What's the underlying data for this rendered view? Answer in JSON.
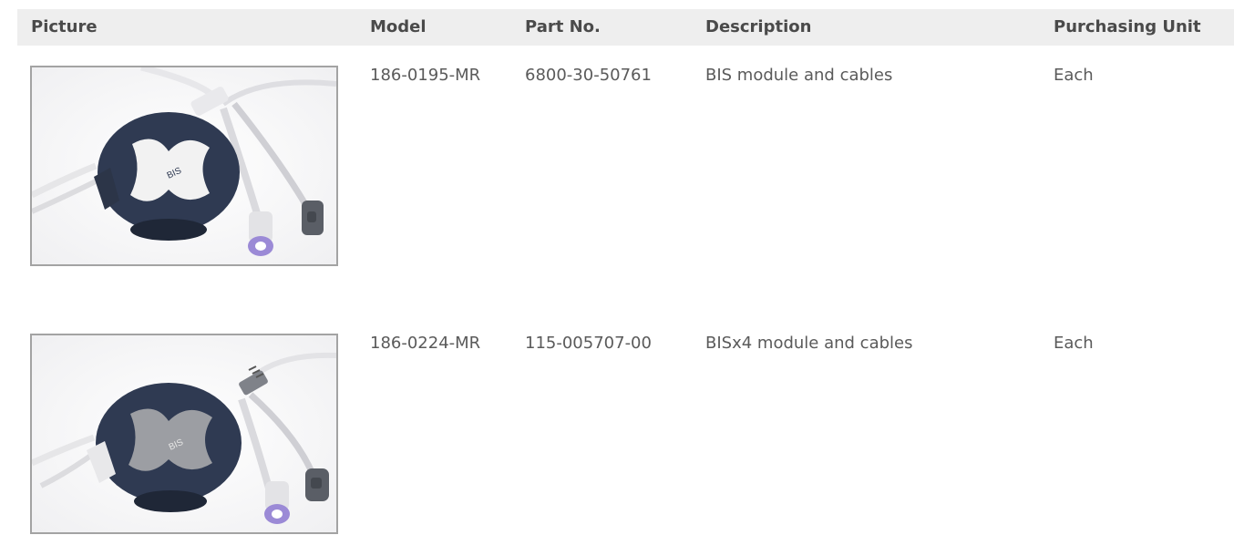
{
  "table": {
    "headers": {
      "picture": "Picture",
      "model": "Model",
      "part_no": "Part No.",
      "description": "Description",
      "purchasing_unit": "Purchasing Unit"
    },
    "rows": [
      {
        "picture": "bis-module-photo",
        "model": "186-0195-MR",
        "part_no": "6800-30-50761",
        "description": "BIS module and cables",
        "purchasing_unit": "Each"
      },
      {
        "picture": "bisx4-module-photo",
        "model": "186-0224-MR",
        "part_no": "115-005707-00",
        "description": "BISx4 module and cables",
        "purchasing_unit": "Each"
      }
    ]
  },
  "colors": {
    "header_bg": "#eeeeee",
    "photo_border": "#a3a3a3",
    "module_body": "#2f3a52",
    "module_face_1": "#f2f2f2",
    "module_face_2": "#9c9ea3",
    "connector_purple": "#9b8ad6",
    "connector_gray": "#5a5e66"
  }
}
